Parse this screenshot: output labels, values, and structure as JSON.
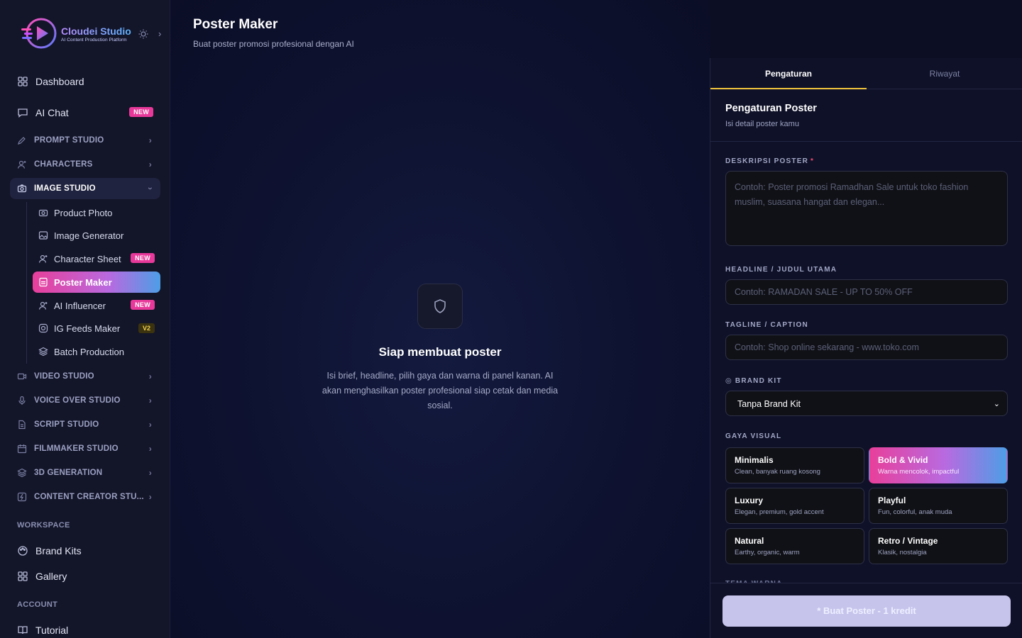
{
  "brand": {
    "name": "Cloudei Studio",
    "tagline": "AI Content Production Platform"
  },
  "sidebar": {
    "top": [
      {
        "label": "Dashboard"
      },
      {
        "label": "AI Chat",
        "badge": "NEW"
      }
    ],
    "sections": [
      {
        "label": "PROMPT STUDIO"
      },
      {
        "label": "CHARACTERS"
      },
      {
        "label": "IMAGE STUDIO"
      },
      {
        "label": "VIDEO STUDIO"
      },
      {
        "label": "VOICE OVER STUDIO"
      },
      {
        "label": "SCRIPT STUDIO"
      },
      {
        "label": "FILMMAKER STUDIO"
      },
      {
        "label": "3D GENERATION"
      },
      {
        "label": "CONTENT CREATOR STU..."
      }
    ],
    "image_studio_items": [
      {
        "label": "Product Photo"
      },
      {
        "label": "Image Generator"
      },
      {
        "label": "Character Sheet",
        "badge": "NEW"
      },
      {
        "label": "Poster Maker"
      },
      {
        "label": "AI Influencer",
        "badge": "NEW"
      },
      {
        "label": "IG Feeds Maker",
        "badge": "V2"
      },
      {
        "label": "Batch Production"
      }
    ],
    "workspace_label": "WORKSPACE",
    "workspace": [
      {
        "label": "Brand Kits"
      },
      {
        "label": "Gallery"
      }
    ],
    "account_label": "ACCOUNT",
    "account": [
      {
        "label": "Tutorial"
      }
    ]
  },
  "main": {
    "title": "Poster Maker",
    "subtitle": "Buat poster promosi profesional dengan AI",
    "empty_title": "Siap membuat poster",
    "empty_desc": "Isi brief, headline, pilih gaya dan warna di panel kanan. AI akan menghasilkan poster profesional siap cetak dan media sosial."
  },
  "panel": {
    "tabs": [
      {
        "label": "Pengaturan"
      },
      {
        "label": "Riwayat"
      }
    ],
    "title": "Pengaturan Poster",
    "subtitle": "Isi detail poster kamu",
    "description": {
      "label": "DESKRIPSI POSTER",
      "required_mark": "*",
      "value": "",
      "placeholder": "Contoh: Poster promosi Ramadhan Sale untuk toko fashion muslim, suasana hangat dan elegan..."
    },
    "headline": {
      "label": "HEADLINE / JUDUL UTAMA",
      "value": "",
      "placeholder": "Contoh: RAMADAN SALE - UP TO 50% OFF"
    },
    "tagline": {
      "label": "TAGLINE / CAPTION",
      "value": "",
      "placeholder": "Contoh: Shop online sekarang - www.toko.com"
    },
    "brand_kit": {
      "label": "BRAND KIT",
      "selected": "Tanpa Brand Kit"
    },
    "visual_style": {
      "label": "GAYA VISUAL",
      "options": [
        {
          "name": "Minimalis",
          "desc": "Clean, banyak ruang kosong"
        },
        {
          "name": "Bold & Vivid",
          "desc": "Warna mencolok, impactful",
          "selected": true
        },
        {
          "name": "Luxury",
          "desc": "Elegan, premium, gold accent"
        },
        {
          "name": "Playful",
          "desc": "Fun, colorful, anak muda"
        },
        {
          "name": "Natural",
          "desc": "Earthy, organic, warm"
        },
        {
          "name": "Retro / Vintage",
          "desc": "Klasik, nostalgia"
        }
      ]
    },
    "next_label": "TEMA WARNA",
    "generate_label": "* Buat Poster - 1 kredit"
  },
  "colors": {
    "accent_pink": "#e83f9a",
    "accent_blue": "#4d9ee6",
    "tab_underline": "#f2c53d",
    "badge_new": "#e8399a"
  }
}
